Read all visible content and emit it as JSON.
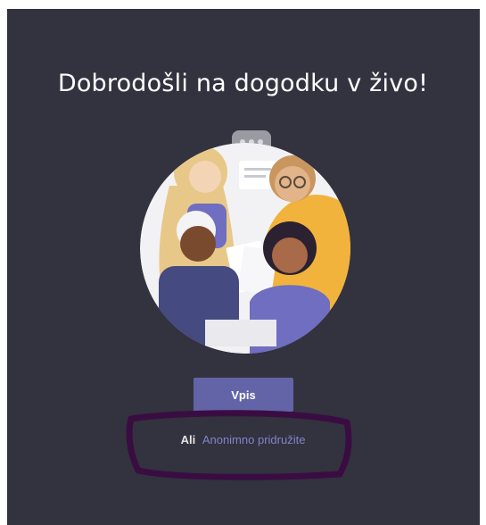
{
  "welcome": {
    "title": "Dobrodošli na dogodku v živo!"
  },
  "actions": {
    "signin_label": "Vpis",
    "or_label": "Ali",
    "anonymous_label": "Anonimno pridružite"
  },
  "colors": {
    "background": "#33323f",
    "primary_button": "#6264a7",
    "link": "#7f85c9",
    "annotation_marker": "#3a0d42"
  },
  "icons": {
    "illustration": "people-meeting-illustration",
    "annotation": "hand-drawn-highlight-outline"
  }
}
